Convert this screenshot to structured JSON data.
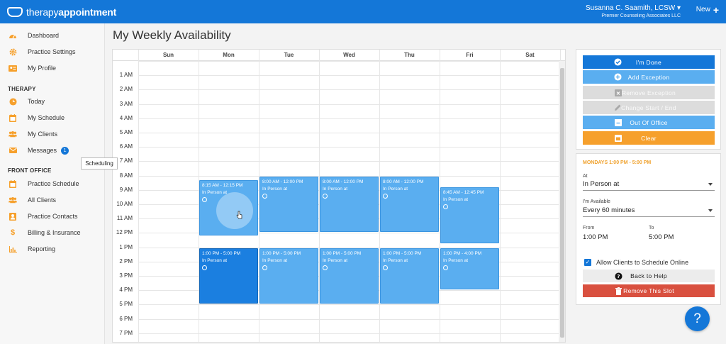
{
  "topbar": {
    "brand_light": "therapy",
    "brand_bold": "appointment",
    "user_name": "Susanna C. Saamith, LCSW",
    "user_caret": "▾",
    "organization": "Premier Counseling Associates LLC",
    "new_label": "New",
    "new_icon": "+"
  },
  "colors": {
    "primary": "#1477d8",
    "slot": "#5aaef0",
    "slot_active": "#1b7fe0",
    "orange": "#f6a02c",
    "disabled": "#dcdcdc",
    "danger": "#d9503f"
  },
  "sidebar": {
    "items_top": [
      {
        "label": "Dashboard",
        "icon": "dashboard-gauge-icon"
      },
      {
        "label": "Practice Settings",
        "icon": "gear-icon"
      },
      {
        "label": "My Profile",
        "icon": "id-card-icon"
      }
    ],
    "therapy_heading": "THERAPY",
    "items_therapy": [
      {
        "label": "Today",
        "icon": "clock-icon"
      },
      {
        "label": "My Schedule",
        "icon": "calendar-icon"
      },
      {
        "label": "My Clients",
        "icon": "users-icon"
      },
      {
        "label": "Messages",
        "icon": "envelope-icon",
        "badge": "1"
      }
    ],
    "front_office_heading": "FRONT OFFICE",
    "items_front": [
      {
        "label": "Practice Schedule",
        "icon": "calendar-icon"
      },
      {
        "label": "All Clients",
        "icon": "users-icon"
      },
      {
        "label": "Practice Contacts",
        "icon": "contact-icon"
      },
      {
        "label": "Billing & Insurance",
        "icon": "dollar-icon"
      },
      {
        "label": "Reporting",
        "icon": "bar-chart-icon"
      }
    ],
    "tooltip": "Scheduling"
  },
  "page": {
    "title": "My Weekly Availability"
  },
  "calendar": {
    "days": [
      "Sun",
      "Mon",
      "Tue",
      "Wed",
      "Thu",
      "Fri",
      "Sat"
    ],
    "hours": [
      "1 AM",
      "2 AM",
      "3 AM",
      "4 AM",
      "5 AM",
      "6 AM",
      "7 AM",
      "8 AM",
      "9 AM",
      "10 AM",
      "11 AM",
      "12 PM",
      "1 PM",
      "2 PM",
      "3 PM",
      "4 PM",
      "5 PM",
      "6 PM",
      "7 PM"
    ],
    "slots": [
      {
        "day": 1,
        "start": 8.25,
        "end": 12.25,
        "time": "8:15 AM - 12:15 PM",
        "place": "In Person at",
        "active": false
      },
      {
        "day": 2,
        "start": 8.0,
        "end": 12.0,
        "time": "8:00 AM - 12:00 PM",
        "place": "In Person at",
        "active": false
      },
      {
        "day": 3,
        "start": 8.0,
        "end": 12.0,
        "time": "8:00 AM - 12:00 PM",
        "place": "In Person at",
        "active": false
      },
      {
        "day": 4,
        "start": 8.0,
        "end": 12.0,
        "time": "8:00 AM - 12:00 PM",
        "place": "In Person at",
        "active": false
      },
      {
        "day": 5,
        "start": 8.75,
        "end": 12.75,
        "time": "8:45 AM - 12:45 PM",
        "place": "In Person at",
        "active": false
      },
      {
        "day": 1,
        "start": 13.0,
        "end": 17.0,
        "time": "1:00 PM - 5:00 PM",
        "place": "In Person at",
        "active": true
      },
      {
        "day": 2,
        "start": 13.0,
        "end": 17.0,
        "time": "1:00 PM - 5:00 PM",
        "place": "In Person at",
        "active": false
      },
      {
        "day": 3,
        "start": 13.0,
        "end": 17.0,
        "time": "1:00 PM - 5:00 PM",
        "place": "In Person at",
        "active": false
      },
      {
        "day": 4,
        "start": 13.0,
        "end": 17.0,
        "time": "1:00 PM - 5:00 PM",
        "place": "In Person at",
        "active": false
      },
      {
        "day": 5,
        "start": 13.0,
        "end": 16.0,
        "time": "1:00 PM - 4:00 PM",
        "place": "In Person at",
        "active": false
      }
    ]
  },
  "actions": {
    "done": "I'm Done",
    "add_exception": "Add Exception",
    "remove_exception": "Remove Exception",
    "change_start_end": "Change Start / End",
    "out_of_office": "Out Of Office",
    "clear": "Clear"
  },
  "details": {
    "title": "MONDAYS 1:00 PM - 5:00 PM",
    "at_label": "At",
    "at_value": "In Person at",
    "available_label": "I'm Available",
    "available_value": "Every 60 minutes",
    "from_label": "From",
    "from_value": "1:00 PM",
    "to_label": "To",
    "to_value": "5:00 PM",
    "allow_online_label": "Allow Clients to Schedule Online",
    "allow_online_checked": "✓",
    "back_to_help": "Back to Help",
    "remove_slot": "Remove This Slot"
  },
  "help_fab": "?"
}
